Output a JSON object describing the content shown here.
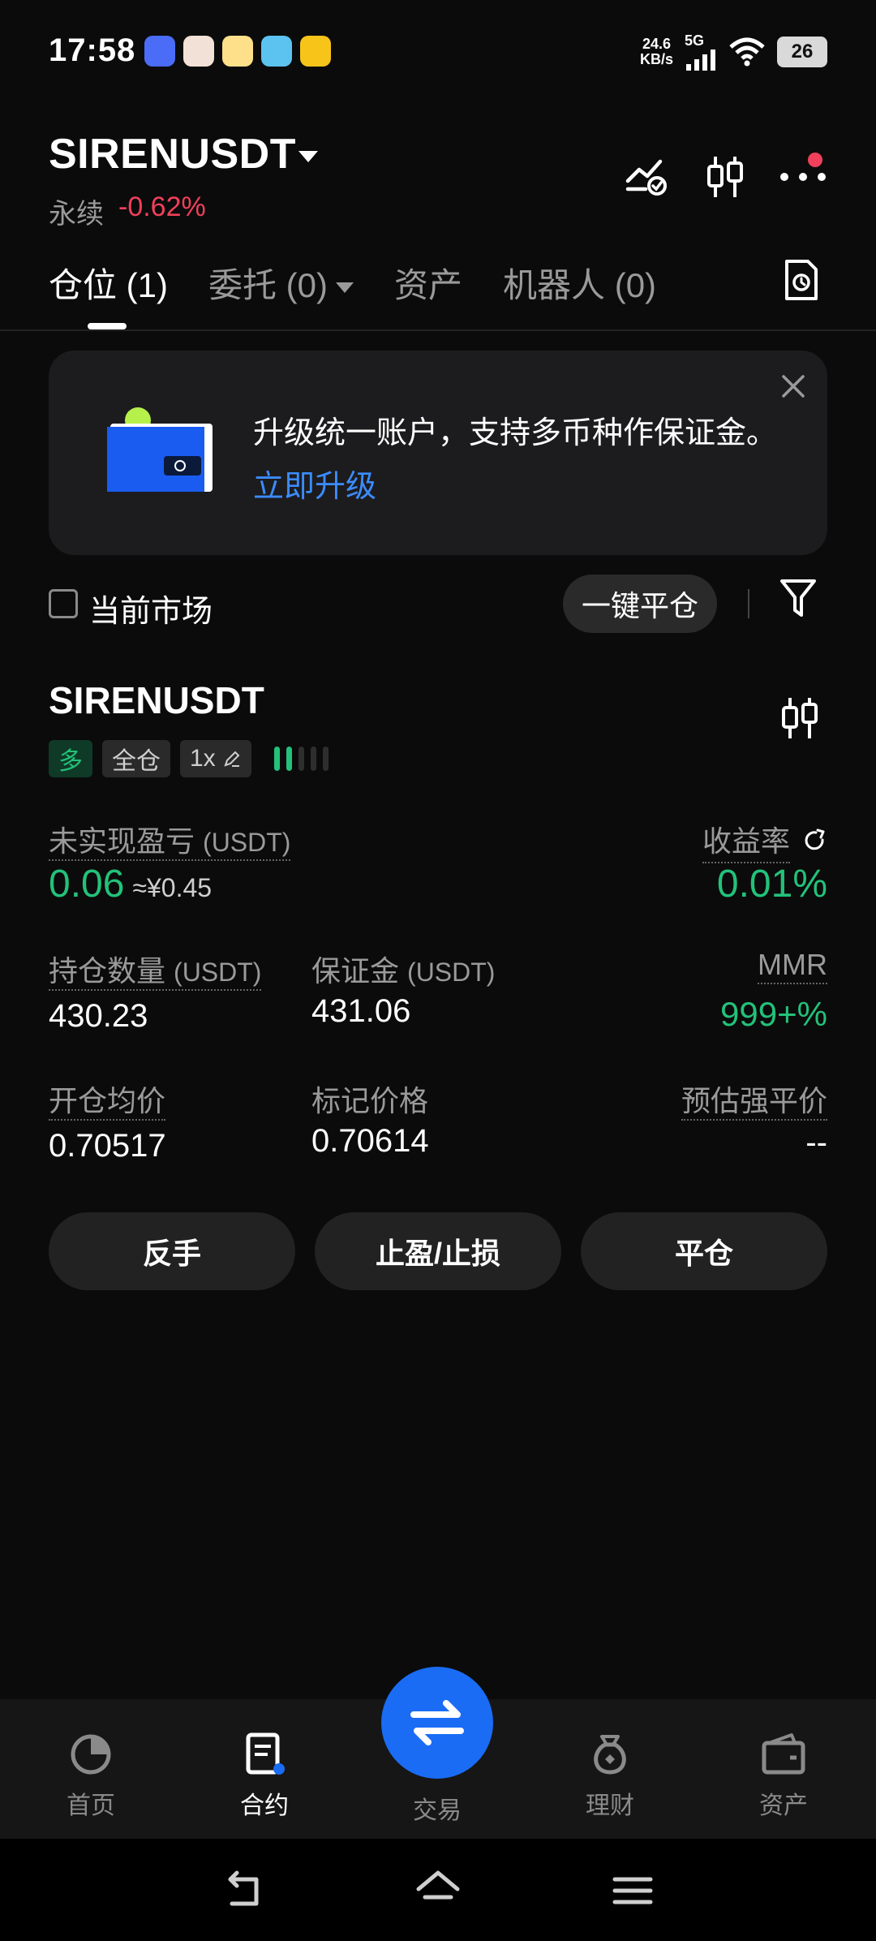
{
  "status_bar": {
    "time": "17:58",
    "net_speed_value": "24.6",
    "net_speed_unit": "KB/s",
    "network": "5G",
    "battery": "26",
    "icons": [
      "bluetooth-app-icon",
      "avatar-app-icon",
      "score-app-icon",
      "wallet-app-icon",
      "tencent-app-icon",
      "signal-icon",
      "wifi-icon",
      "battery-icon"
    ]
  },
  "header": {
    "symbol": "SIRENUSDT",
    "type_label": "永续",
    "change": "-0.62%",
    "icons": [
      "strategy-icon",
      "candlestick-icon",
      "more-icon"
    ]
  },
  "tabs": [
    {
      "label": "仓位 (1)",
      "active": true
    },
    {
      "label": "委托 (0)",
      "active": false
    },
    {
      "label": "资产",
      "active": false
    },
    {
      "label": "机器人 (0)",
      "active": false
    }
  ],
  "banner": {
    "text": "升级统一账户，支持多币种作保证金。",
    "link": "立即升级"
  },
  "filter": {
    "current_market_label": "当前市场",
    "close_all_label": "一键平仓"
  },
  "position": {
    "symbol": "SIRENUSDT",
    "side_tag": "多",
    "margin_tag": "全仓",
    "leverage_tag": "1x",
    "adl_level": 2,
    "unrealized_pnl_label": "未实现盈亏",
    "unrealized_pnl_unit": "(USDT)",
    "unrealized_pnl": "0.06",
    "unrealized_pnl_cny": "≈¥0.45",
    "roi_label": "收益率",
    "roi": "0.01%",
    "size_label": "持仓数量",
    "size_unit": "(USDT)",
    "size": "430.23",
    "margin_label": "保证金",
    "margin_unit": "(USDT)",
    "margin": "431.06",
    "mmr_label": "MMR",
    "mmr": "999+%",
    "entry_label": "开仓均价",
    "entry": "0.70517",
    "mark_label": "标记价格",
    "mark": "0.70614",
    "liq_label": "预估强平价",
    "liq": "--"
  },
  "actions": {
    "reverse": "反手",
    "tpsl": "止盈/止损",
    "close": "平仓"
  },
  "bottom_nav": {
    "home": "首页",
    "contract": "合约",
    "trade": "交易",
    "finance": "理财",
    "assets": "资产"
  },
  "colors": {
    "green": "#23c17a",
    "red": "#f0405b",
    "blue": "#1a6cf5",
    "link": "#3b8cff"
  }
}
